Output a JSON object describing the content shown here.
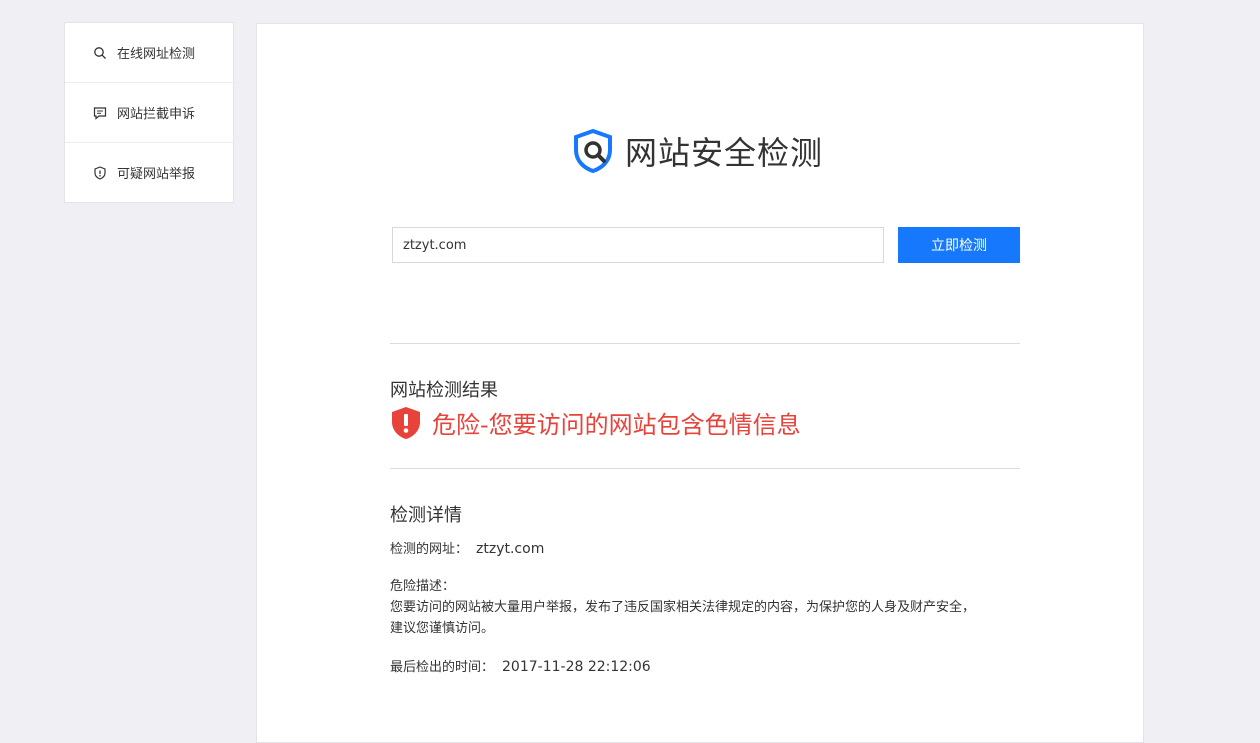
{
  "sidebar": {
    "items": [
      {
        "label": "在线网址检测",
        "icon": "search-icon"
      },
      {
        "label": "网站拦截申诉",
        "icon": "message-icon"
      },
      {
        "label": "可疑网站举报",
        "icon": "shield-alert-icon"
      }
    ]
  },
  "header": {
    "title": "网站安全检测"
  },
  "search": {
    "value": "ztzyt.com",
    "button_label": "立即检测"
  },
  "result": {
    "section_title": "网站检测结果",
    "status_text": "危险-您要访问的网站包含色情信息",
    "status_color": "#e8433b"
  },
  "details": {
    "section_title": "检测详情",
    "url_label": "检测的网址：",
    "url_value": "ztzyt.com",
    "risk_label": "危险描述：",
    "risk_line1": "您要访问的网站被大量用户举报，发布了违反国家相关法律规定的内容，为保护您的人身及财产安全，",
    "risk_line2": "建议您谨慎访问。",
    "time_label": "最后检出的时间：",
    "time_value": "2017-11-28 22:12:06"
  },
  "colors": {
    "accent": "#1678fc",
    "danger": "#e8433b",
    "background": "#efeff4"
  }
}
